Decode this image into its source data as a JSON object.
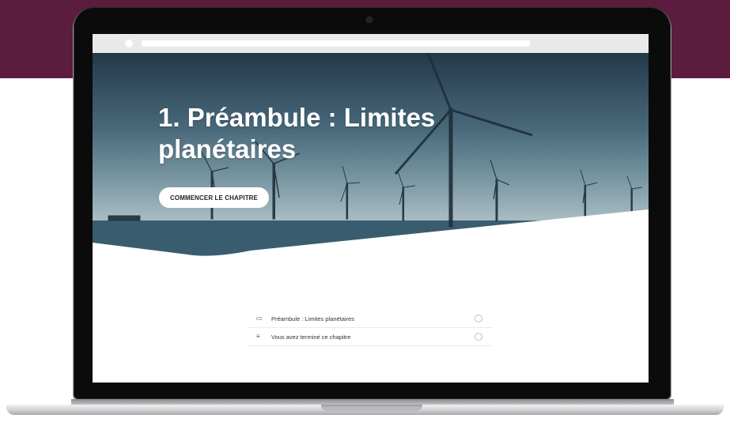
{
  "hero": {
    "title": "1. Préambule : Limites planétaires",
    "cta_label": "COMMENCER LE CHAPITRE"
  },
  "lessons": [
    {
      "icon": "folder-outline-icon",
      "label": "Préambule : Limites planétaires"
    },
    {
      "icon": "text-lines-icon",
      "label": "Vous avez terminé ce chapitre"
    }
  ],
  "colors": {
    "background_band": "#5b1c3e",
    "button_bg": "#ffffff"
  }
}
